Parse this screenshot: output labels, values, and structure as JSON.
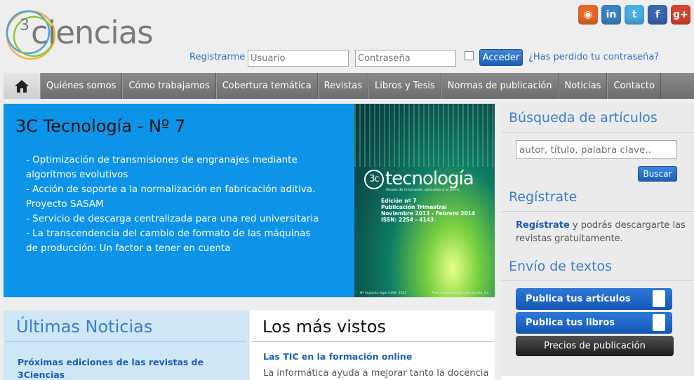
{
  "logo": {
    "text": "ciencias",
    "superscript": "3"
  },
  "social": [
    {
      "icon": "rss-icon",
      "glyph": "◉",
      "color": "#e8692b"
    },
    {
      "icon": "linkedin-icon",
      "glyph": "in",
      "color": "#3a83c7"
    },
    {
      "icon": "twitter-icon",
      "glyph": "t",
      "color": "#4aaee4"
    },
    {
      "icon": "facebook-icon",
      "glyph": "f",
      "color": "#3c66b0"
    },
    {
      "icon": "googleplus-icon",
      "glyph": "g+",
      "color": "#d8442d"
    }
  ],
  "login": {
    "register_label": "Registrarme",
    "user_placeholder": "Usuario",
    "password_placeholder": "Contraseña",
    "submit_label": "Acceder",
    "forgot_label": "¿Has perdido tu contraseña?"
  },
  "nav": {
    "items": [
      "Quiénes somos",
      "Cómo trabajamos",
      "Cobertura temática",
      "Revistas",
      "Libros y Tesis",
      "Normas de publicación",
      "Noticias",
      "Contacto"
    ]
  },
  "banner": {
    "title": "3C Tecnología - Nº 7",
    "items": [
      "- Optimización de transmisiones de engranajes mediante algoritmos evolutivos",
      "- Acción de soporte a la normalización en fabricación aditiva. Proyecto SASAM",
      "- Servicio de descarga centralizada para una red universitaria",
      "- La transcendencia del cambio de formato de las máquinas de producción: Un factor a tener en cuenta"
    ],
    "cover": {
      "badge": "3c",
      "title": "tecnología",
      "subtitle": "Glosas de innovación aplicadas a la pyme",
      "edition": "Edición nº 7",
      "frequency": "Publicación Trimestral",
      "period": "Noviembre 2013 - Febrero 2014",
      "issn": "ISSN: 2254 - 4143",
      "foot_left": "Nº depósito legal A268- 2012",
      "foot_right": "Área de Innovación y Desarrollo, S.L."
    }
  },
  "sidebar": {
    "search_title": "Búsqueda de artículos",
    "search_placeholder": "autor, título, palabra clave..",
    "search_button": "Buscar",
    "register_title": "Regístrate",
    "register_link": "Regístrate",
    "register_text": " y podrás descargarte las revistas gratuitamente.",
    "submit_title": "Envío de textos",
    "publish_articles": "Publica tus artículos",
    "publish_books": "Publica tus libros",
    "prices": "Precios de publicación"
  },
  "news": {
    "title": "Últimas Noticias",
    "first_item": "Próximas ediciones de las revistas de 3Ciencias"
  },
  "most_viewed": {
    "title": "Los más vistos",
    "first_item": "Las TIC en la formación online",
    "snippet": "La informática ayuda a mejorar tanto la docencia"
  }
}
